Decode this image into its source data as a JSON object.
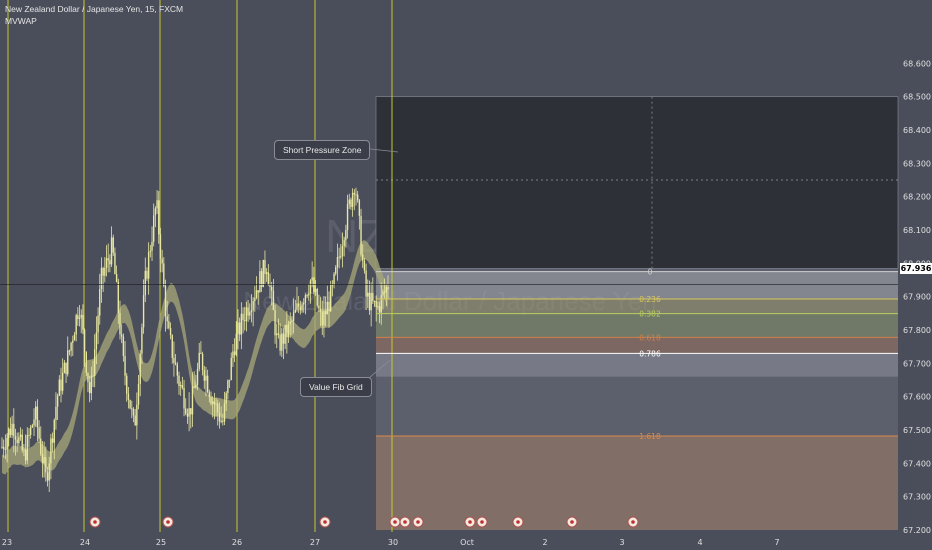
{
  "header": {
    "symbol_line": "New Zealand Dollar / Japanese Yen, 15, FXCM",
    "indicator": "MVWAP"
  },
  "watermark": {
    "ticker": "NZDJPY, 15",
    "name": "New Zealand Dollar / Japanese Yen"
  },
  "current_price": "67.936",
  "annotations": {
    "short_zone": "Short Pressure Zone",
    "value_grid": "Value Fib Grid"
  },
  "chart_data": {
    "type": "candlestick",
    "title": "New Zealand Dollar / Japanese Yen, 15, FXCM",
    "ylim": [
      67.2,
      68.7
    ],
    "yticks": [
      "68.600",
      "68.500",
      "68.400",
      "68.300",
      "68.200",
      "68.100",
      "68.000",
      "67.900",
      "67.800",
      "67.700",
      "67.600",
      "67.500",
      "67.400",
      "67.300",
      "67.200"
    ],
    "xticks": [
      "23",
      "24",
      "25",
      "26",
      "27",
      "30",
      "Oct",
      "2",
      "3",
      "4",
      "7"
    ],
    "day_separators": [
      "24",
      "25",
      "26",
      "27",
      "30"
    ],
    "price_path": [
      67.45,
      67.52,
      67.42,
      67.55,
      67.35,
      67.6,
      67.72,
      67.88,
      67.6,
      67.95,
      68.05,
      67.7,
      67.5,
      67.95,
      68.18,
      67.8,
      67.65,
      67.55,
      67.72,
      67.6,
      67.52,
      67.75,
      67.85,
      67.92,
      68.0,
      67.75,
      67.8,
      67.88,
      67.95,
      67.82,
      67.92,
      68.1,
      68.25,
      67.9,
      67.86,
      67.936
    ],
    "fib_levels": [
      {
        "label": "0",
        "price": 67.975,
        "color": "#d0d0d0"
      },
      {
        "label": "0.236",
        "price": 67.893,
        "color": "#d9c85a"
      },
      {
        "label": "0.382",
        "price": 67.849,
        "color": "#b8d060"
      },
      {
        "label": "0.618",
        "price": 67.778,
        "color": "#d0804a"
      },
      {
        "label": "0.786",
        "price": 67.73,
        "color": "#ffffff"
      },
      {
        "label": "1.618",
        "price": 67.482,
        "color": "#d98a4a"
      }
    ],
    "zones": {
      "short_pressure": {
        "top": 68.5,
        "bottom": 67.985,
        "color": "#2e3038"
      },
      "fib_grid": {
        "top": 67.985,
        "bottom": 67.2
      }
    }
  },
  "colors": {
    "background": "#4a4d5a",
    "candle": "#e8e8a0",
    "separator": "#c8c830",
    "mvwap": "#a8a878"
  }
}
